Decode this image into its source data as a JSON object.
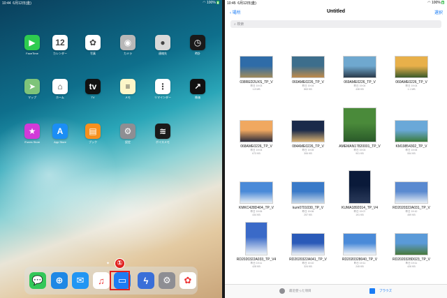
{
  "left": {
    "status": {
      "time": "10:44",
      "date": "6月12日(金)",
      "battery": "100%"
    },
    "apps": [
      {
        "label": "FaceTime",
        "name": "facetime-app",
        "icon": "facetime-icon",
        "color": "#2ecc4f",
        "glyph": "▶"
      },
      {
        "label": "カレンダー",
        "name": "calendar-app",
        "icon": "calendar-icon",
        "color": "#ffffff",
        "glyph": "12"
      },
      {
        "label": "写真",
        "name": "photos-app",
        "icon": "photos-icon",
        "color": "#ffffff",
        "glyph": "✿"
      },
      {
        "label": "カメラ",
        "name": "camera-app",
        "icon": "camera-icon",
        "color": "#b8b8b8",
        "glyph": "◉"
      },
      {
        "label": "連絡先",
        "name": "contacts-app",
        "icon": "contacts-icon",
        "color": "#d9d9d9",
        "glyph": "●"
      },
      {
        "label": "時計",
        "name": "clock-app",
        "icon": "clock-icon",
        "color": "#1a1a1a",
        "glyph": "◷"
      },
      {
        "label": "マップ",
        "name": "maps-app",
        "icon": "maps-icon",
        "color": "#7ec47a",
        "glyph": "➤"
      },
      {
        "label": "ホーム",
        "name": "home-app",
        "icon": "home-icon",
        "color": "#ffffff",
        "glyph": "⌂"
      },
      {
        "label": "TV",
        "name": "tv-app",
        "icon": "tv-icon",
        "color": "#111111",
        "glyph": "tv"
      },
      {
        "label": "メモ",
        "name": "notes-app",
        "icon": "notes-icon",
        "color": "#fdf6c8",
        "glyph": "≡"
      },
      {
        "label": "リマインダー",
        "name": "reminders-app",
        "icon": "reminders-icon",
        "color": "#ffffff",
        "glyph": "⋮"
      },
      {
        "label": "株価",
        "name": "stocks-app",
        "icon": "stocks-icon",
        "color": "#111111",
        "glyph": "↗"
      },
      {
        "label": "iTunes Store",
        "name": "itunes-store-app",
        "icon": "star-icon",
        "color": "#d23ad8",
        "glyph": "★"
      },
      {
        "label": "App Store",
        "name": "app-store-app",
        "icon": "app-store-icon",
        "color": "#1b8ef5",
        "glyph": "A"
      },
      {
        "label": "ブック",
        "name": "books-app",
        "icon": "books-icon",
        "color": "#f6901e",
        "glyph": "▤"
      },
      {
        "label": "設定",
        "name": "settings-app",
        "icon": "gear-icon",
        "color": "#8e8e93",
        "glyph": "⚙"
      },
      {
        "label": "ボイスメモ",
        "name": "voice-memos-app",
        "icon": "waveform-icon",
        "color": "#1a1a1a",
        "glyph": "≋"
      }
    ],
    "dock": [
      {
        "name": "messages-dock-icon",
        "color": "#34c759",
        "glyph": "💬"
      },
      {
        "name": "safari-dock-icon",
        "color": "#1e88e5",
        "glyph": "⊕"
      },
      {
        "name": "mail-dock-icon",
        "color": "#2196f3",
        "glyph": "✉"
      },
      {
        "name": "music-dock-icon",
        "color": "#ffffff",
        "glyph": "♫"
      },
      {
        "name": "files-dock-icon",
        "color": "#1e7cf2",
        "glyph": "▭"
      },
      {
        "name": "app-dock-icon",
        "color": "#3a6fd8",
        "glyph": "ϟ"
      },
      {
        "name": "settings-dock-icon",
        "color": "#8e8e93",
        "glyph": "⚙"
      },
      {
        "name": "photos-dock-icon",
        "color": "#ffffff",
        "glyph": "✿"
      }
    ],
    "annotation": "①"
  },
  "right": {
    "status": {
      "time": "10:45",
      "date": "6月12日(金)",
      "battery": "100%"
    },
    "back_label": "場所",
    "title": "Untitled",
    "select_label": "選択",
    "search_placeholder": "検索",
    "files": [
      {
        "name": "038RED2UXS_TP_V",
        "date": "昨日 19:03",
        "size": "1.8 MB",
        "c1": "#2f6ca8",
        "c2": "#a08a5a"
      },
      {
        "name": "060AME0226_TP_V",
        "date": "昨日 19:04",
        "size": "863 KB",
        "c1": "#3d6e8c",
        "c2": "#c08a4a"
      },
      {
        "name": "069AME0226_TP_V",
        "date": "昨日 19:04",
        "size": "438 KB",
        "c1": "#6fa8cf",
        "c2": "#2a3a4a"
      },
      {
        "name": "060AME0226_TP_V",
        "date": "昨日 19:04",
        "size": "1.1 MB",
        "c1": "#e8b04a",
        "c2": "#3a5a2a"
      },
      {
        "name": "068AME0226_TP_V",
        "date": "昨日 19:04",
        "size": "673 KB",
        "c1": "#f0a860",
        "c2": "#2a2a3a"
      },
      {
        "name": "084AME0226_TP_V",
        "date": "昨日 19:05",
        "size": "306 KB",
        "c1": "#1a2a4a",
        "c2": "#d8b070"
      },
      {
        "name": "AMEMAN17820001_TP_V",
        "date": "昨日 19:03",
        "size": "901 KB",
        "c1": "#4a8a3a",
        "c2": "#2a5a2a"
      },
      {
        "name": "KM19854302_TP_V",
        "date": "昨日 19:06",
        "size": "554 KB",
        "c1": "#6aa8d8",
        "c2": "#3a7a3a"
      },
      {
        "name": "KMKC428D404_TP_V",
        "date": "昨日 19:06",
        "size": "434 KB",
        "c1": "#4a8ad8",
        "c2": "#e8eef4"
      },
      {
        "name": "kum0701030_TP_V",
        "date": "昨日 19:06",
        "size": "257 KB",
        "c1": "#3a7ac8",
        "c2": "#c8d8e8"
      },
      {
        "name": "KUMA1892014_TP_V4",
        "date": "昨日 19:07",
        "size": "191 KB",
        "c1": "#0a1a3a",
        "c2": "#2a3a5a"
      },
      {
        "name": "RD2020322A031_TP_V",
        "date": "昨日 19:10",
        "size": "459 KB",
        "c1": "#5a8ad0",
        "c2": "#e8eef4"
      },
      {
        "name": "RD2020322A033_TP_V4",
        "date": "昨日 19:11",
        "size": "428 KB",
        "c1": "#3a6ac8",
        "c2": "#f0f4f8"
      },
      {
        "name": "RD2020322A041_TP_V",
        "date": "昨日 19:10",
        "size": "324 KB",
        "c1": "#2a5ab8",
        "c2": "#f0f4f8"
      },
      {
        "name": "RD2020328040_TP_V",
        "date": "昨日 19:11",
        "size": "245 KB",
        "c1": "#4a8ad8",
        "c2": "#f4f6f8"
      },
      {
        "name": "RD2020328D023_TP_V",
        "date": "昨日 19:11",
        "size": "426 KB",
        "c1": "#5a9ad8",
        "c2": "#4a7a3a"
      }
    ],
    "tabs": {
      "recent": "最近使った項目",
      "browse": "ブラウズ"
    }
  }
}
